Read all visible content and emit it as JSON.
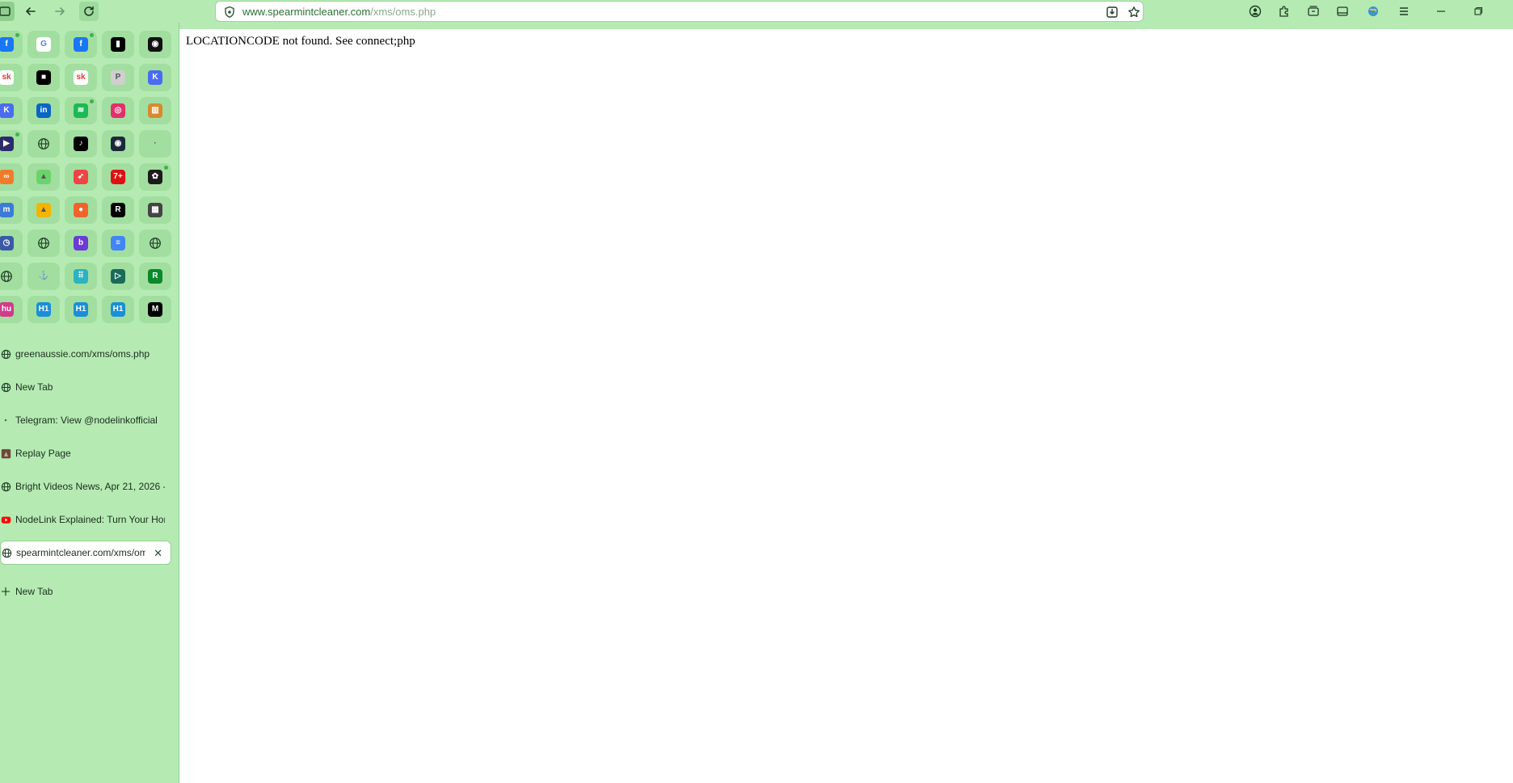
{
  "browser": {
    "url_host": "www.spearmintcleaner.com",
    "url_path": "/xms/oms.php"
  },
  "pinned": [
    {
      "icon": "facebook-icon",
      "glyph": "f",
      "color": "#1877f2"
    },
    {
      "icon": "google-icon",
      "glyph": "G",
      "color": "#ffffff"
    },
    {
      "icon": "facebook-icon",
      "glyph": "f",
      "color": "#1877f2"
    },
    {
      "icon": "app-icon",
      "glyph": "▮",
      "color": "#000000"
    },
    {
      "icon": "app-icon",
      "glyph": "◉",
      "color": "#111111"
    },
    {
      "icon": "sk-icon",
      "glyph": "sk",
      "color": "#ffffff"
    },
    {
      "icon": "chat-icon",
      "glyph": "■",
      "color": "#000000"
    },
    {
      "icon": "sk-icon",
      "glyph": "sk",
      "color": "#ffffff"
    },
    {
      "icon": "p-icon",
      "glyph": "P",
      "color": "#cfcfcf"
    },
    {
      "icon": "k-icon",
      "glyph": "K",
      "color": "#4a6cf0"
    },
    {
      "icon": "k-icon",
      "glyph": "K",
      "color": "#4a6cf0"
    },
    {
      "icon": "linkedin-icon",
      "glyph": "in",
      "color": "#0a66c2"
    },
    {
      "icon": "spotify-icon",
      "glyph": "≋",
      "color": "#1db954"
    },
    {
      "icon": "instagram-icon",
      "glyph": "◎",
      "color": "#e1306c"
    },
    {
      "icon": "app-icon",
      "glyph": "▥",
      "color": "#d98a2b"
    },
    {
      "icon": "play-icon",
      "glyph": "▶",
      "color": "#2b2b6a"
    },
    {
      "icon": "globe-icon",
      "glyph": "",
      "color": "transparent"
    },
    {
      "icon": "tiktok-icon",
      "glyph": "♪",
      "color": "#000000"
    },
    {
      "icon": "app-icon",
      "glyph": "◉",
      "color": "#1a2a3a"
    },
    {
      "icon": "dot-icon",
      "glyph": "·",
      "color": "transparent"
    },
    {
      "icon": "link-icon",
      "glyph": "∞",
      "color": "#f07c2b"
    },
    {
      "icon": "app-icon",
      "glyph": "▲",
      "color": "#6bd36b"
    },
    {
      "icon": "cursor-icon",
      "glyph": "➶",
      "color": "#e44"
    },
    {
      "icon": "seven-plus-icon",
      "glyph": "7+",
      "color": "#d11"
    },
    {
      "icon": "openai-icon",
      "glyph": "✿",
      "color": "#1b1b1b"
    },
    {
      "icon": "m-icon",
      "glyph": "m",
      "color": "#3c7bd8"
    },
    {
      "icon": "drive-icon",
      "glyph": "▲",
      "color": "#f4b400"
    },
    {
      "icon": "app-icon",
      "glyph": "●",
      "color": "#f0642b"
    },
    {
      "icon": "app-icon",
      "glyph": "R",
      "color": "#000000"
    },
    {
      "icon": "photo-icon",
      "glyph": "▦",
      "color": "#444444"
    },
    {
      "icon": "clock-icon",
      "glyph": "◷",
      "color": "#3a5aa8"
    },
    {
      "icon": "globe-icon",
      "glyph": "",
      "color": "transparent"
    },
    {
      "icon": "b-icon",
      "glyph": "b",
      "color": "#6a3bd6"
    },
    {
      "icon": "docs-icon",
      "glyph": "≡",
      "color": "#4285f4"
    },
    {
      "icon": "globe-icon",
      "glyph": "",
      "color": "transparent"
    },
    {
      "icon": "globe-icon",
      "glyph": "",
      "color": "transparent"
    },
    {
      "icon": "app-icon",
      "glyph": "⚓",
      "color": "transparent"
    },
    {
      "icon": "grid-icon",
      "glyph": "⠿",
      "color": "#2bb3c0"
    },
    {
      "icon": "play-circle-icon",
      "glyph": "▷",
      "color": "#1b6b5a"
    },
    {
      "icon": "app-icon",
      "glyph": "R",
      "color": "#0b8a2b"
    },
    {
      "icon": "app-icon",
      "glyph": "hu",
      "color": "#d23b8a"
    },
    {
      "icon": "h1-icon",
      "glyph": "H1",
      "color": "#1a8fd8"
    },
    {
      "icon": "h1-icon",
      "glyph": "H1",
      "color": "#1a8fd8"
    },
    {
      "icon": "h1-icon",
      "glyph": "H1",
      "color": "#1a8fd8"
    },
    {
      "icon": "medium-icon",
      "glyph": "M",
      "color": "#000000"
    }
  ],
  "tabs": [
    {
      "label": "greenaussie.com/xms/oms.php",
      "icon": "globe-icon"
    },
    {
      "label": "New Tab",
      "icon": "globe-icon"
    },
    {
      "label": "Telegram: View @nodelinkofficial",
      "icon": "telegram-icon"
    },
    {
      "label": "Replay Page",
      "icon": "replay-icon"
    },
    {
      "label": "Bright Videos News, Apr 21, 2026 -",
      "icon": "globe-icon"
    },
    {
      "label": "NodeLink Explained: Turn Your Hom",
      "icon": "youtube-icon"
    },
    {
      "label": "spearmintcleaner.com/xms/oms.php",
      "icon": "globe-icon",
      "active": true
    }
  ],
  "new_tab_label": "New Tab",
  "page": {
    "message": "LOCATIONCODE not found. See connect;php"
  }
}
